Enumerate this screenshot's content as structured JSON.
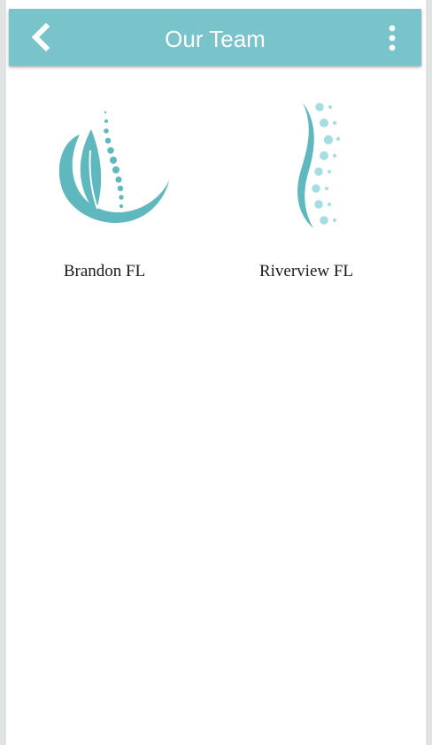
{
  "header": {
    "title": "Our Team",
    "back_icon": "chevron-left-icon",
    "menu_icon": "more-vertical-icon",
    "background_color": "#79c3ca",
    "text_color": "#ffffff"
  },
  "locations": [
    {
      "label": "Brandon FL",
      "logo": "leaf-spine-logo",
      "accent_color": "#5fb8be"
    },
    {
      "label": "Riverview FL",
      "logo": "curved-spine-logo",
      "accent_color": "#a6dde2"
    }
  ]
}
